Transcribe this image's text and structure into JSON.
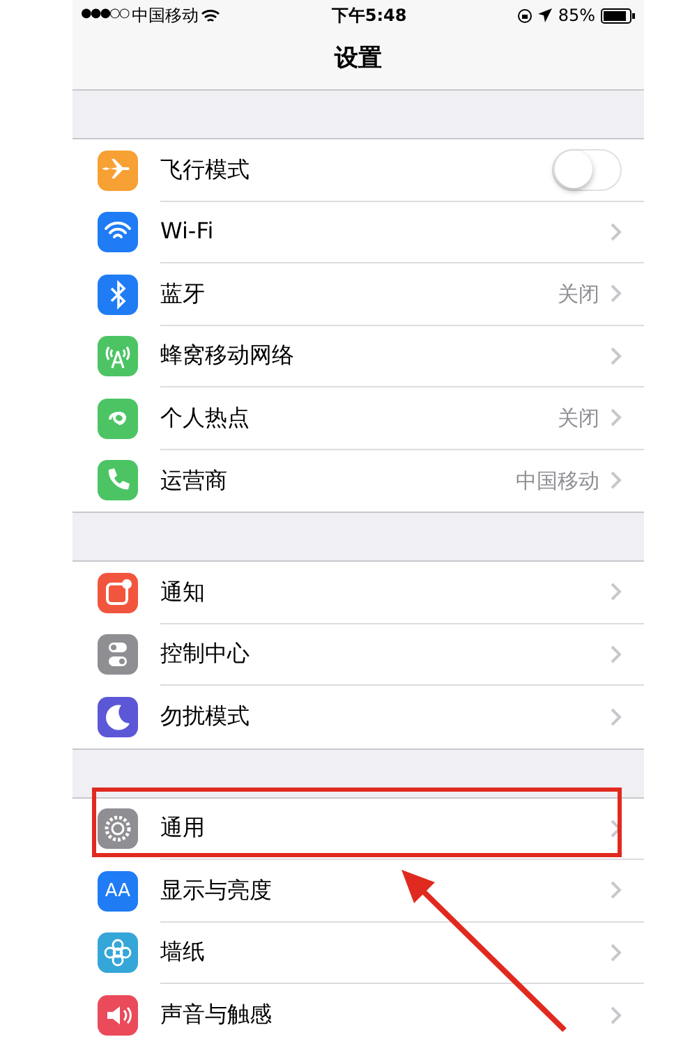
{
  "status_bar": {
    "signal": "●●●○○",
    "carrier": "中国移动",
    "time": "下午5:48",
    "battery": "85%"
  },
  "title": "设置",
  "groups": [
    {
      "items": [
        {
          "label": "飞行模式",
          "kind": "toggle",
          "on": false,
          "color": "#f7a033"
        },
        {
          "label": "Wi-Fi",
          "kind": "link",
          "color": "#1f7cf5"
        },
        {
          "label": "蓝牙",
          "kind": "link",
          "value": "关闭",
          "color": "#1f7cf5"
        },
        {
          "label": "蜂窝移动网络",
          "kind": "link",
          "color": "#4cc464"
        },
        {
          "label": "个人热点",
          "kind": "link",
          "value": "关闭",
          "color": "#4cc464"
        },
        {
          "label": "运营商",
          "kind": "link",
          "value": "中国移动",
          "color": "#4cc464"
        }
      ]
    },
    {
      "items": [
        {
          "label": "通知",
          "kind": "link",
          "color": "#f2553d"
        },
        {
          "label": "控制中心",
          "kind": "link",
          "color": "#8e8e93"
        },
        {
          "label": "勿扰模式",
          "kind": "link",
          "color": "#5b57d6"
        }
      ]
    },
    {
      "items": [
        {
          "label": "通用",
          "kind": "link",
          "color": "#8e8e93",
          "highlighted": true
        },
        {
          "label": "显示与亮度",
          "kind": "link",
          "color": "#1f7cf5",
          "icon_text": "AA"
        },
        {
          "label": "墙纸",
          "kind": "link",
          "color": "#35a6d8"
        },
        {
          "label": "声音与触感",
          "kind": "link",
          "color": "#ea4a5a"
        }
      ]
    }
  ]
}
